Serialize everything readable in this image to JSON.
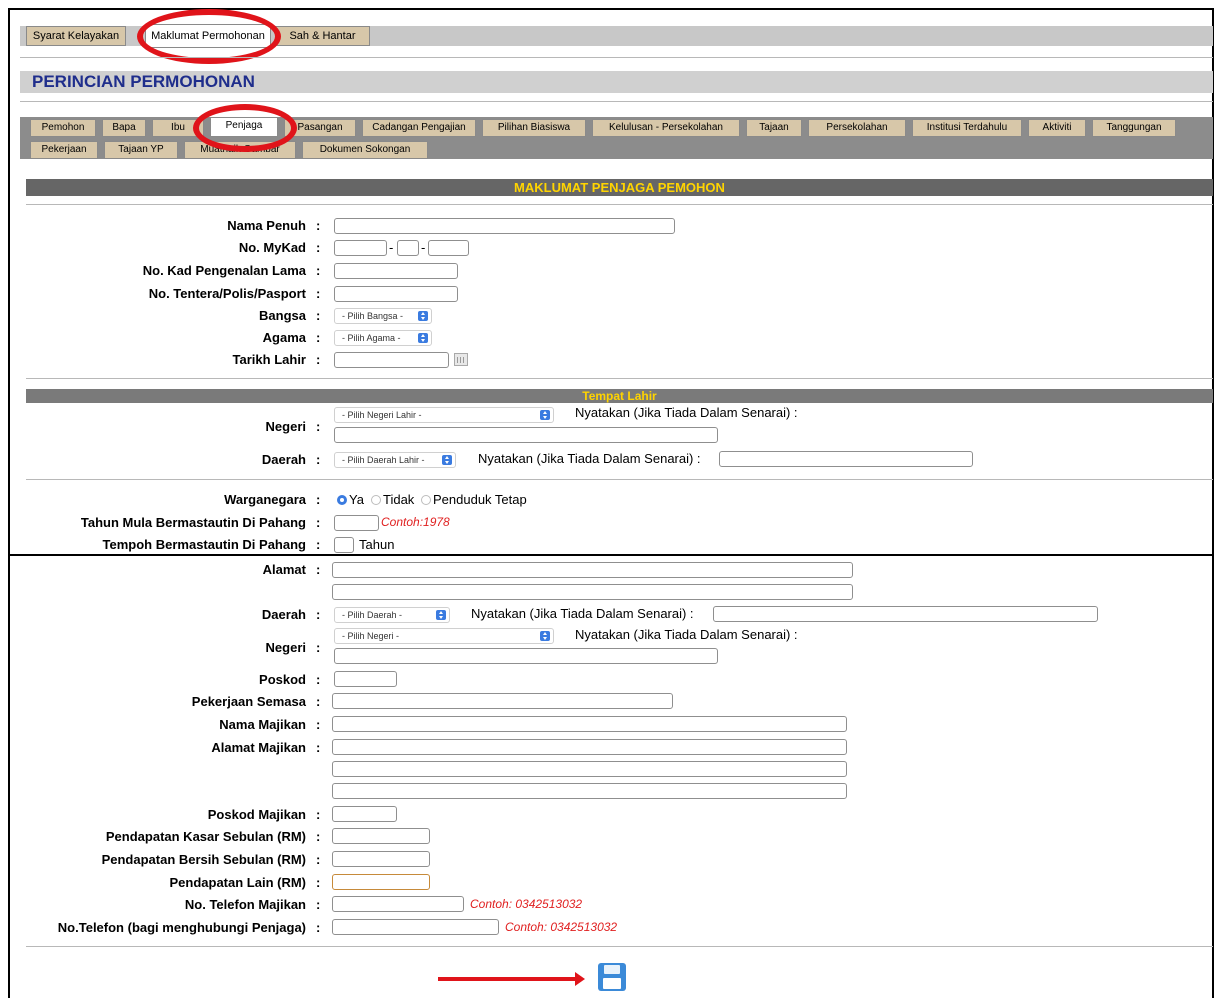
{
  "top_tabs": [
    "Syarat Kelayakan",
    "Maklumat Permohonan",
    "Sah & Hantar"
  ],
  "section_title": "PERINCIAN PERMOHONAN",
  "sub_tabs_row1": [
    "Pemohon",
    "Bapa",
    "Ibu",
    "Penjaga",
    "Pasangan",
    "Cadangan Pengajian",
    "Pilihan Biasiswa",
    "Kelulusan - Persekolahan",
    "Tajaan",
    "Persekolahan",
    "Institusi Terdahulu",
    "Aktiviti",
    "Tanggungan"
  ],
  "sub_tabs_row2": [
    "Pekerjaan",
    "Tajaan YP",
    "Muatnaik Gambar",
    "Dokumen Sokongan"
  ],
  "banner_main": "MAKLUMAT PENJAGA PEMOHON",
  "banner_birth": "Tempat Lahir",
  "labels": {
    "nama_penuh": "Nama Penuh",
    "mykad": "No. MyKad",
    "kp_lama": "No. Kad Pengenalan Lama",
    "tentera": "No. Tentera/Polis/Pasport",
    "bangsa": "Bangsa",
    "agama": "Agama",
    "tarikh_lahir": "Tarikh Lahir",
    "negeri": "Negeri",
    "daerah": "Daerah",
    "warganegara": "Warganegara",
    "tahun_mula": "Tahun Mula Bermastautin Di Pahang",
    "tempoh": "Tempoh Bermastautin Di Pahang",
    "alamat": "Alamat",
    "daerah2": "Daerah",
    "negeri2": "Negeri",
    "poskod": "Poskod",
    "pekerjaan": "Pekerjaan Semasa",
    "nama_majikan": "Nama Majikan",
    "alamat_majikan": "Alamat Majikan",
    "poskod_majikan": "Poskod Majikan",
    "kasar": "Pendapatan Kasar Sebulan (RM)",
    "bersih": "Pendapatan Bersih Sebulan (RM)",
    "lain": "Pendapatan Lain (RM)",
    "tel_majikan": "No. Telefon Majikan",
    "tel_penjaga": "No.Telefon (bagi menghubungi Penjaga)"
  },
  "colon": ":",
  "dash": "-",
  "selects": {
    "bangsa": "- Pilih Bangsa -",
    "agama": "- Pilih Agama -",
    "negeri_lahir": "- Pilih Negeri Lahir -",
    "daerah_lahir": "- Pilih Daerah Lahir -",
    "daerah": "- Pilih Daerah -",
    "negeri": "- Pilih Negeri -"
  },
  "nyatakan": "Nyatakan (Jika Tiada Dalam Senarai) :",
  "radio": {
    "ya": "Ya",
    "tidak": "Tidak",
    "penduduk": "Penduduk Tetap"
  },
  "hints": {
    "tahun": "Contoh:1978",
    "tel": "Contoh: 0342513032"
  },
  "tahun_unit": "Tahun",
  "colors": {
    "accent_red": "#e0141a",
    "banner_text": "#ffd400",
    "title_blue": "#1f2e8c"
  },
  "icons": {
    "save": "floppy-disk-icon",
    "calendar": "calendar-icon"
  }
}
